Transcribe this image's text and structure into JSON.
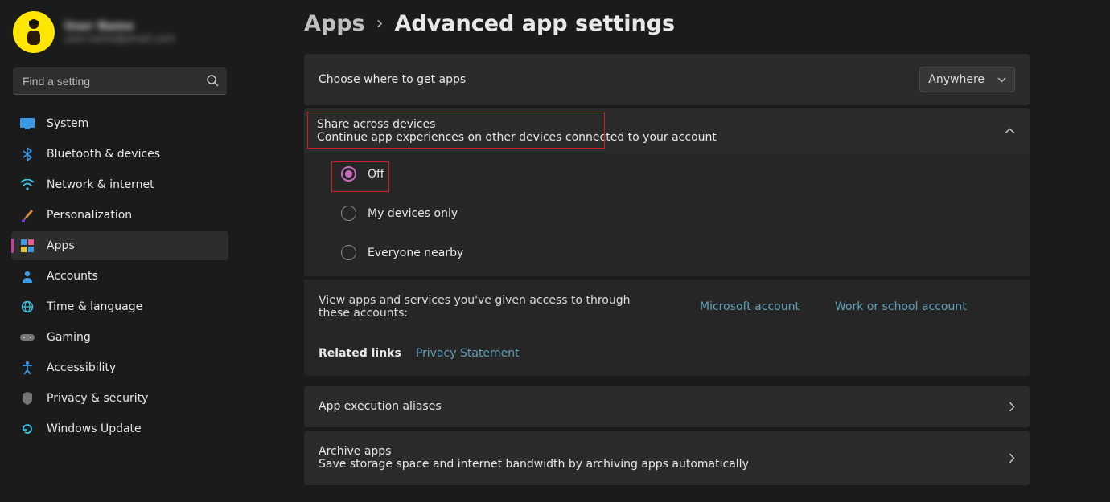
{
  "profile": {
    "name": "User Name",
    "email": "user.name@email.com"
  },
  "search": {
    "placeholder": "Find a setting"
  },
  "sidebar": {
    "items": [
      {
        "label": "System"
      },
      {
        "label": "Bluetooth & devices"
      },
      {
        "label": "Network & internet"
      },
      {
        "label": "Personalization"
      },
      {
        "label": "Apps"
      },
      {
        "label": "Accounts"
      },
      {
        "label": "Time & language"
      },
      {
        "label": "Gaming"
      },
      {
        "label": "Accessibility"
      },
      {
        "label": "Privacy & security"
      },
      {
        "label": "Windows Update"
      }
    ]
  },
  "breadcrumb": {
    "parent": "Apps",
    "sep": "›",
    "current": "Advanced app settings"
  },
  "getApps": {
    "title": "Choose where to get apps",
    "selected": "Anywhere"
  },
  "share": {
    "title": "Share across devices",
    "sub": "Continue app experiences on other devices connected to your account",
    "options": [
      {
        "label": "Off"
      },
      {
        "label": "My devices only"
      },
      {
        "label": "Everyone nearby"
      }
    ]
  },
  "access": {
    "label": "View apps and services you've given access to through these accounts:",
    "link1": "Microsoft account",
    "link2": "Work or school account"
  },
  "related": {
    "title": "Related links",
    "link": "Privacy Statement"
  },
  "aliases": {
    "title": "App execution aliases"
  },
  "archive": {
    "title": "Archive apps",
    "sub": "Save storage space and internet bandwidth by archiving apps automatically"
  }
}
